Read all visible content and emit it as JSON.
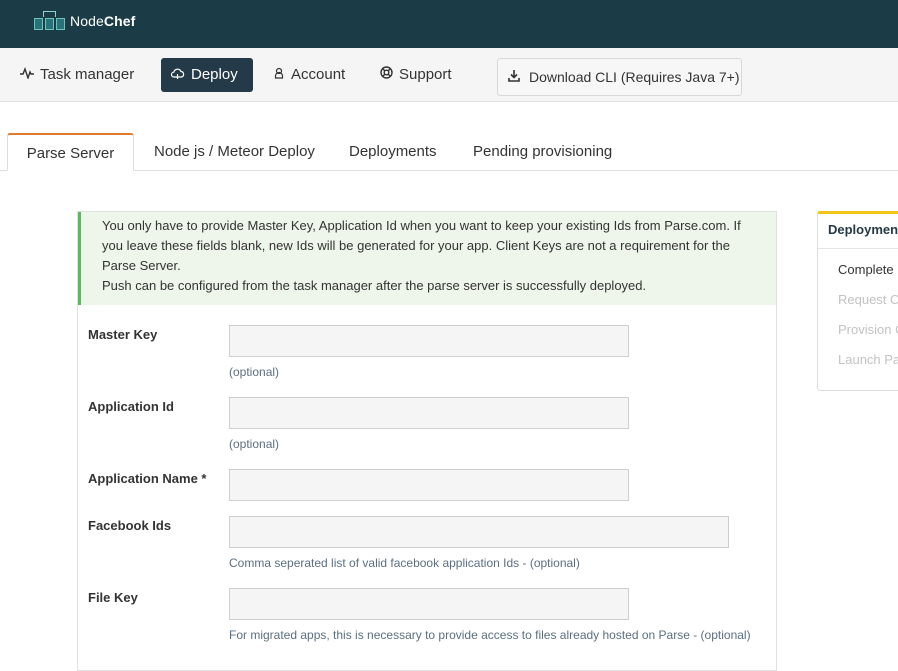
{
  "brand": {
    "name_regular": "Node",
    "name_bold": "Chef"
  },
  "nav": {
    "items": [
      {
        "label": "Task manager",
        "icon": "pulse-icon"
      },
      {
        "label": "Deploy",
        "icon": "cloud-icon",
        "active": true
      },
      {
        "label": "Account",
        "icon": "user-icon"
      },
      {
        "label": "Support",
        "icon": "lifebuoy-icon"
      }
    ],
    "cli_button": {
      "label": "Download CLI (Requires Java 7+)",
      "icon": "download-icon"
    }
  },
  "tabs": [
    {
      "label": "Parse Server",
      "active": true
    },
    {
      "label": "Node js / Meteor Deploy"
    },
    {
      "label": "Deployments"
    },
    {
      "label": "Pending provisioning"
    }
  ],
  "alert": {
    "line1": "You only have to provide Master Key, Application Id when you want to keep your existing Ids from Parse.com. If you leave these fields blank, new Ids will be generated for your app. Client Keys are not a requirement for the Parse Server.",
    "line2": "Push can be configured from the task manager after the parse server is successfully deployed."
  },
  "form": {
    "master_key": {
      "label": "Master Key",
      "value": "",
      "help": "(optional)"
    },
    "application_id": {
      "label": "Application Id",
      "value": "",
      "help": "(optional)"
    },
    "application_name": {
      "label": "Application Name *",
      "value": ""
    },
    "facebook_ids": {
      "label": "Facebook Ids",
      "value": "",
      "help": "Comma seperated list of valid facebook application Ids - (optional)"
    },
    "file_key": {
      "label": "File Key",
      "value": "",
      "help": "For migrated apps, this is necessary to provide access to files already hosted on Parse - (optional)"
    }
  },
  "side_panel": {
    "title": "Deployment",
    "steps": [
      {
        "label": "Complete",
        "state": "done"
      },
      {
        "label": "Request C",
        "state": "pending"
      },
      {
        "label": "Provision C",
        "state": "pending"
      },
      {
        "label": "Launch Pa",
        "state": "pending"
      }
    ]
  },
  "colors": {
    "topbar": "#1b3c47",
    "active_nav": "#253a48",
    "tab_accent": "#e07b2c",
    "alert_border": "#5cb85c",
    "side_accent": "#f0c419"
  }
}
